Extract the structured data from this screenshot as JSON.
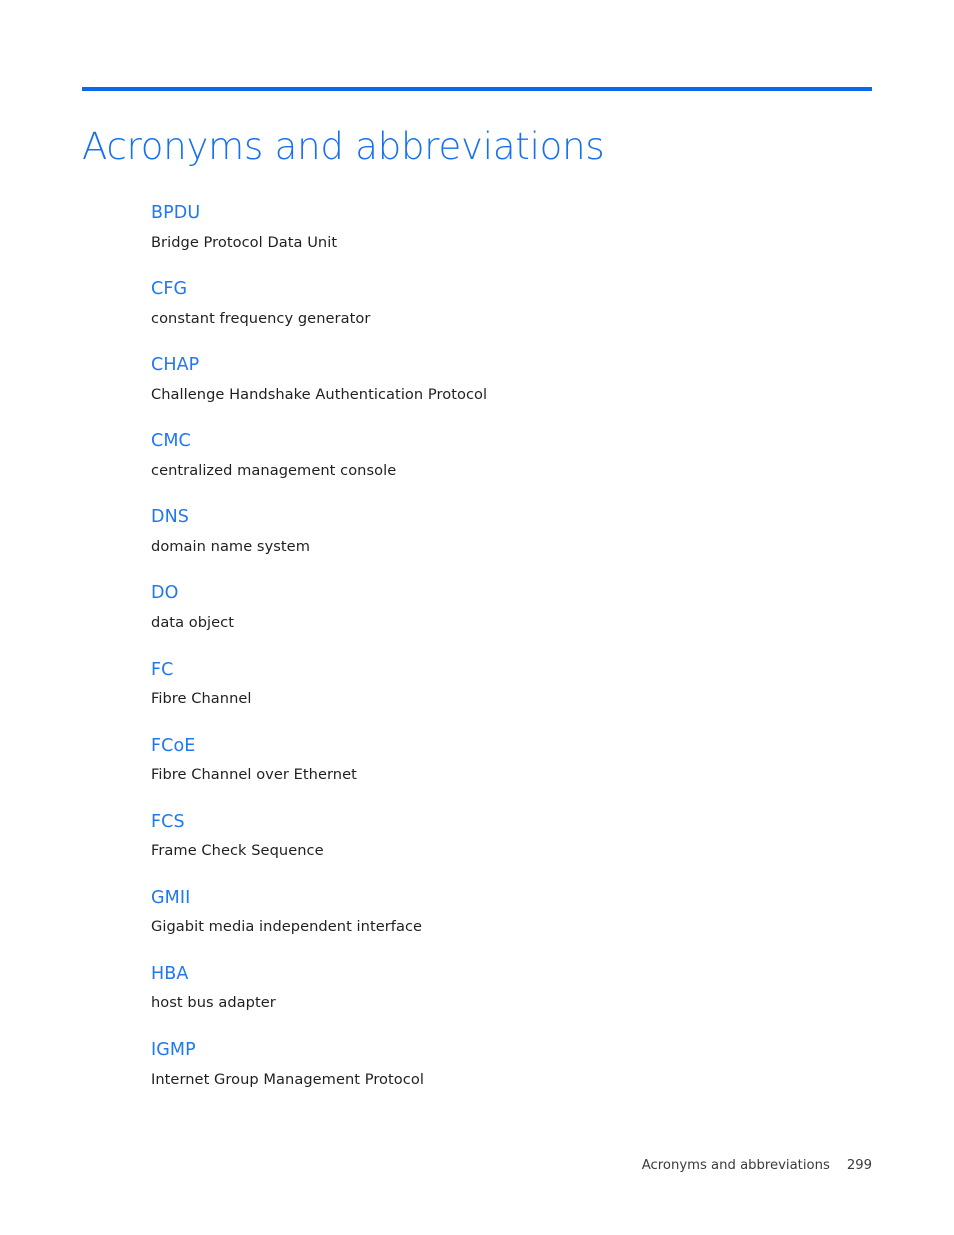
{
  "document": {
    "title": "Acronyms and abbreviations",
    "accent_color": "#0b67ee",
    "title_color": "#1670f0",
    "term_color": "#2077ef",
    "definition_color": "#231f20",
    "background_color": "#ffffff"
  },
  "glossary": {
    "entries": [
      {
        "term": "BPDU",
        "definition": "Bridge Protocol Data Unit"
      },
      {
        "term": "CFG",
        "definition": "constant frequency generator"
      },
      {
        "term": "CHAP",
        "definition": "Challenge Handshake Authentication Protocol"
      },
      {
        "term": "CMC",
        "definition": "centralized management console"
      },
      {
        "term": "DNS",
        "definition": "domain name system"
      },
      {
        "term": "DO",
        "definition": "data object"
      },
      {
        "term": "FC",
        "definition": "Fibre Channel"
      },
      {
        "term": "FCoE",
        "definition": "Fibre Channel over Ethernet"
      },
      {
        "term": "FCS",
        "definition": "Frame Check Sequence"
      },
      {
        "term": "GMII",
        "definition": "Gigabit media independent interface"
      },
      {
        "term": "HBA",
        "definition": "host bus adapter"
      },
      {
        "term": "IGMP",
        "definition": "Internet Group Management Protocol"
      }
    ]
  },
  "footer": {
    "label": "Acronyms and abbreviations",
    "page_number": "299"
  }
}
